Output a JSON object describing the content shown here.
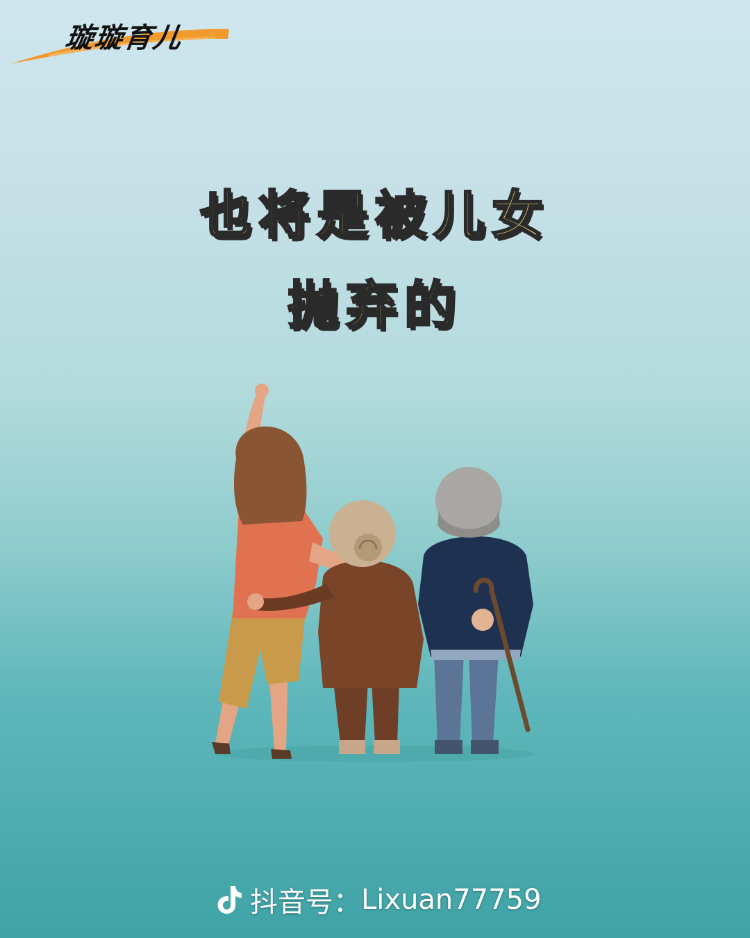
{
  "logo": {
    "text": "璇璇育儿",
    "accent_color": "#f29a2e"
  },
  "title": {
    "line1": "也将是被儿女",
    "line2": "抛弃的",
    "color": "#f6e07a"
  },
  "illustration": {
    "subject": "daughter-with-elderly-parents-back-view"
  },
  "watermark": {
    "icon": "tiktok-icon",
    "label": "抖音号：",
    "handle": "Lixuan77759"
  }
}
